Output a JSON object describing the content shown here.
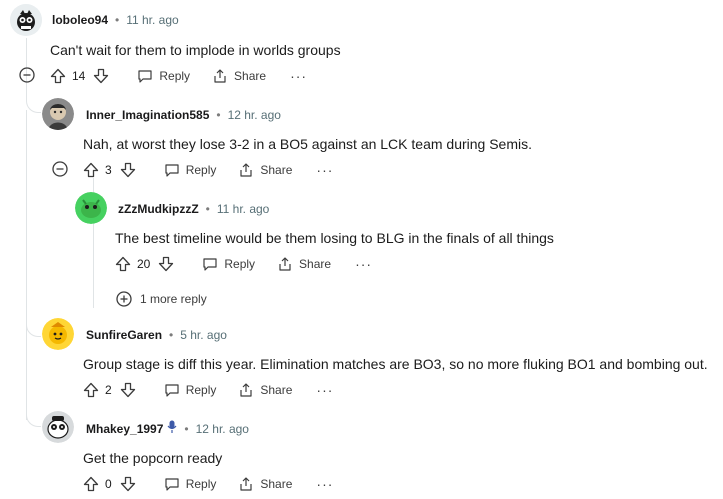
{
  "comments": [
    {
      "username": "loboleo94",
      "time": "11 hr. ago",
      "text": "Can't wait for them to implode in worlds groups",
      "votes": "14",
      "reply": "Reply",
      "share": "Share",
      "more": "···",
      "avatar_color": "#e9eef0"
    },
    {
      "username": "Inner_Imagination585",
      "time": "12 hr. ago",
      "text": "Nah, at worst they lose 3-2 in a BO5 against an LCK team during Semis.",
      "votes": "3",
      "reply": "Reply",
      "share": "Share",
      "more": "···",
      "avatar_color": "#6b6b6b"
    },
    {
      "username": "zZzMudkipzzZ",
      "time": "11 hr. ago",
      "text": "The best timeline would be them losing to BLG in the finals of all things",
      "votes": "20",
      "reply": "Reply",
      "share": "Share",
      "more": "···",
      "avatar_color": "#46d160"
    },
    {
      "username": "SunfireGaren",
      "time": "5 hr. ago",
      "text": "Group stage is diff this year. Elimination matches are BO3, so no more fluking BO1 and bombing out.",
      "votes": "2",
      "reply": "Reply",
      "share": "Share",
      "more": "···",
      "avatar_color": "#ffd635"
    },
    {
      "username": "Mhakey_1997",
      "time": "12 hr. ago",
      "text": "Get the popcorn ready",
      "votes": "0",
      "reply": "Reply",
      "share": "Share",
      "more": "···",
      "avatar_color": "#d7dadc"
    }
  ],
  "more_replies": "1 more reply",
  "colors": {
    "accent_blue": "#3d5aa8",
    "meta_gray": "#576f76",
    "line": "#e0e4e6"
  }
}
